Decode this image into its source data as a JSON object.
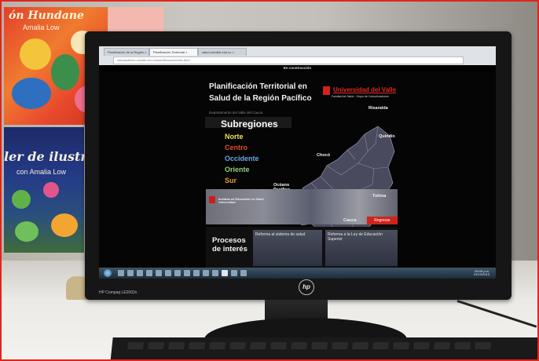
{
  "scene": {
    "poster_left_top": {
      "title": "ón Hundane",
      "subtitle": "Amalia Low"
    },
    "poster_left_bottom": {
      "title": "ler de ilustració",
      "subtitle": "con Amalia Low"
    },
    "monitor_brand": "HP Compaq LE2002x",
    "hp_logo": "hp"
  },
  "browser": {
    "tabs": [
      "Planificación de la Región ×",
      "Planificación Territorial ×",
      "salud.univalle.edu.co ×"
    ],
    "address": "saludpublica.univalle.edu.co/planificacion/index.html"
  },
  "page": {
    "top_notice": "En construcción",
    "title": "Planificación Territorial en Salud de la Región Pacífico",
    "university": "Universidad del Valle",
    "faculty": "Facultad de Salud - Grupo de Comunicaciones",
    "department": "Departamento del Valle del Cauca",
    "subregions_heading": "Subregiones",
    "regions": [
      {
        "label": "Norte",
        "color": "#f1e04a"
      },
      {
        "label": "Centro",
        "color": "#e8462e"
      },
      {
        "label": "Occidente",
        "color": "#6aa6e6"
      },
      {
        "label": "Oriente",
        "color": "#8fd07a"
      },
      {
        "label": "Sur",
        "color": "#f09a2a"
      }
    ],
    "map_labels": {
      "risaralda": "Risaralda",
      "quindio": "Quindío",
      "choco": "Chocó",
      "oceano": "Océano Pacífico",
      "tolima": "Tolima",
      "cauca": "Cauca"
    },
    "banner_text": "Instituto de Educación en Salud Universidad",
    "regresar": "Regresar",
    "procesos": "Procesos de interés",
    "cards": [
      "Reforma al sistema de salud",
      "Reforma a la Ley de Educación Superior"
    ]
  },
  "taskbar": {
    "time": "09:05 p.m.",
    "date": "22/10/2013"
  }
}
